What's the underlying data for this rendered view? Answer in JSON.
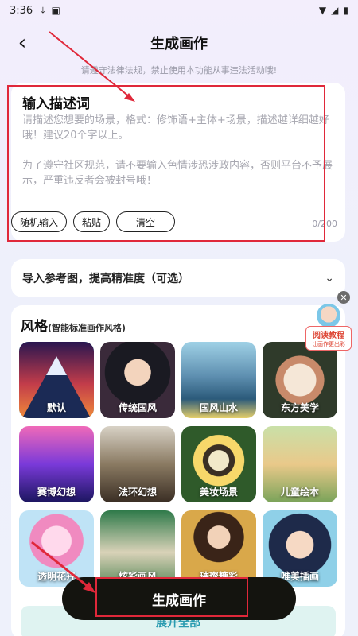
{
  "status_bar": {
    "time": "3:36"
  },
  "header": {
    "title": "生成画作",
    "back_icon": "back-arrow-icon"
  },
  "notice": "请遵守法律法规，禁止使用本功能从事违法活动哦!",
  "prompt": {
    "title": "输入描述词",
    "placeholder_line1": "请描述您想要的场景，格式：修饰语+主体+场景，描述越详细越好哦！建议20个字以上。",
    "placeholder_line2": "为了遵守社区规范，请不要输入色情涉恐涉政内容，否则平台不予展示，严重违反者会被封号哦！",
    "chips": [
      "随机输入",
      "粘贴",
      "清空"
    ],
    "counter": "0/200"
  },
  "import_ref": {
    "label": "导入参考图，提高精准度（可选）"
  },
  "style": {
    "title": "风格",
    "subtitle": "(智能标准画作风格)",
    "tiles": [
      {
        "label": "默认",
        "selected": true
      },
      {
        "label": "传统国风"
      },
      {
        "label": "国风山水"
      },
      {
        "label": "东方美学"
      },
      {
        "label": "赛博幻想"
      },
      {
        "label": "法环幻想"
      },
      {
        "label": "美妆场景"
      },
      {
        "label": "儿童绘本"
      },
      {
        "label": "透明花卉"
      },
      {
        "label": "炫彩画风"
      },
      {
        "label": "璀璨糖彩"
      },
      {
        "label": "唯美插画"
      }
    ],
    "expand_label": "展开全部"
  },
  "tutorial": {
    "line1": "阅读教程",
    "line2": "让画作更出彩"
  },
  "generate_button": "生成画作",
  "colors": {
    "accent": "#22d3e6",
    "highlight_box": "#e0283a",
    "button_bg": "#14140f"
  }
}
